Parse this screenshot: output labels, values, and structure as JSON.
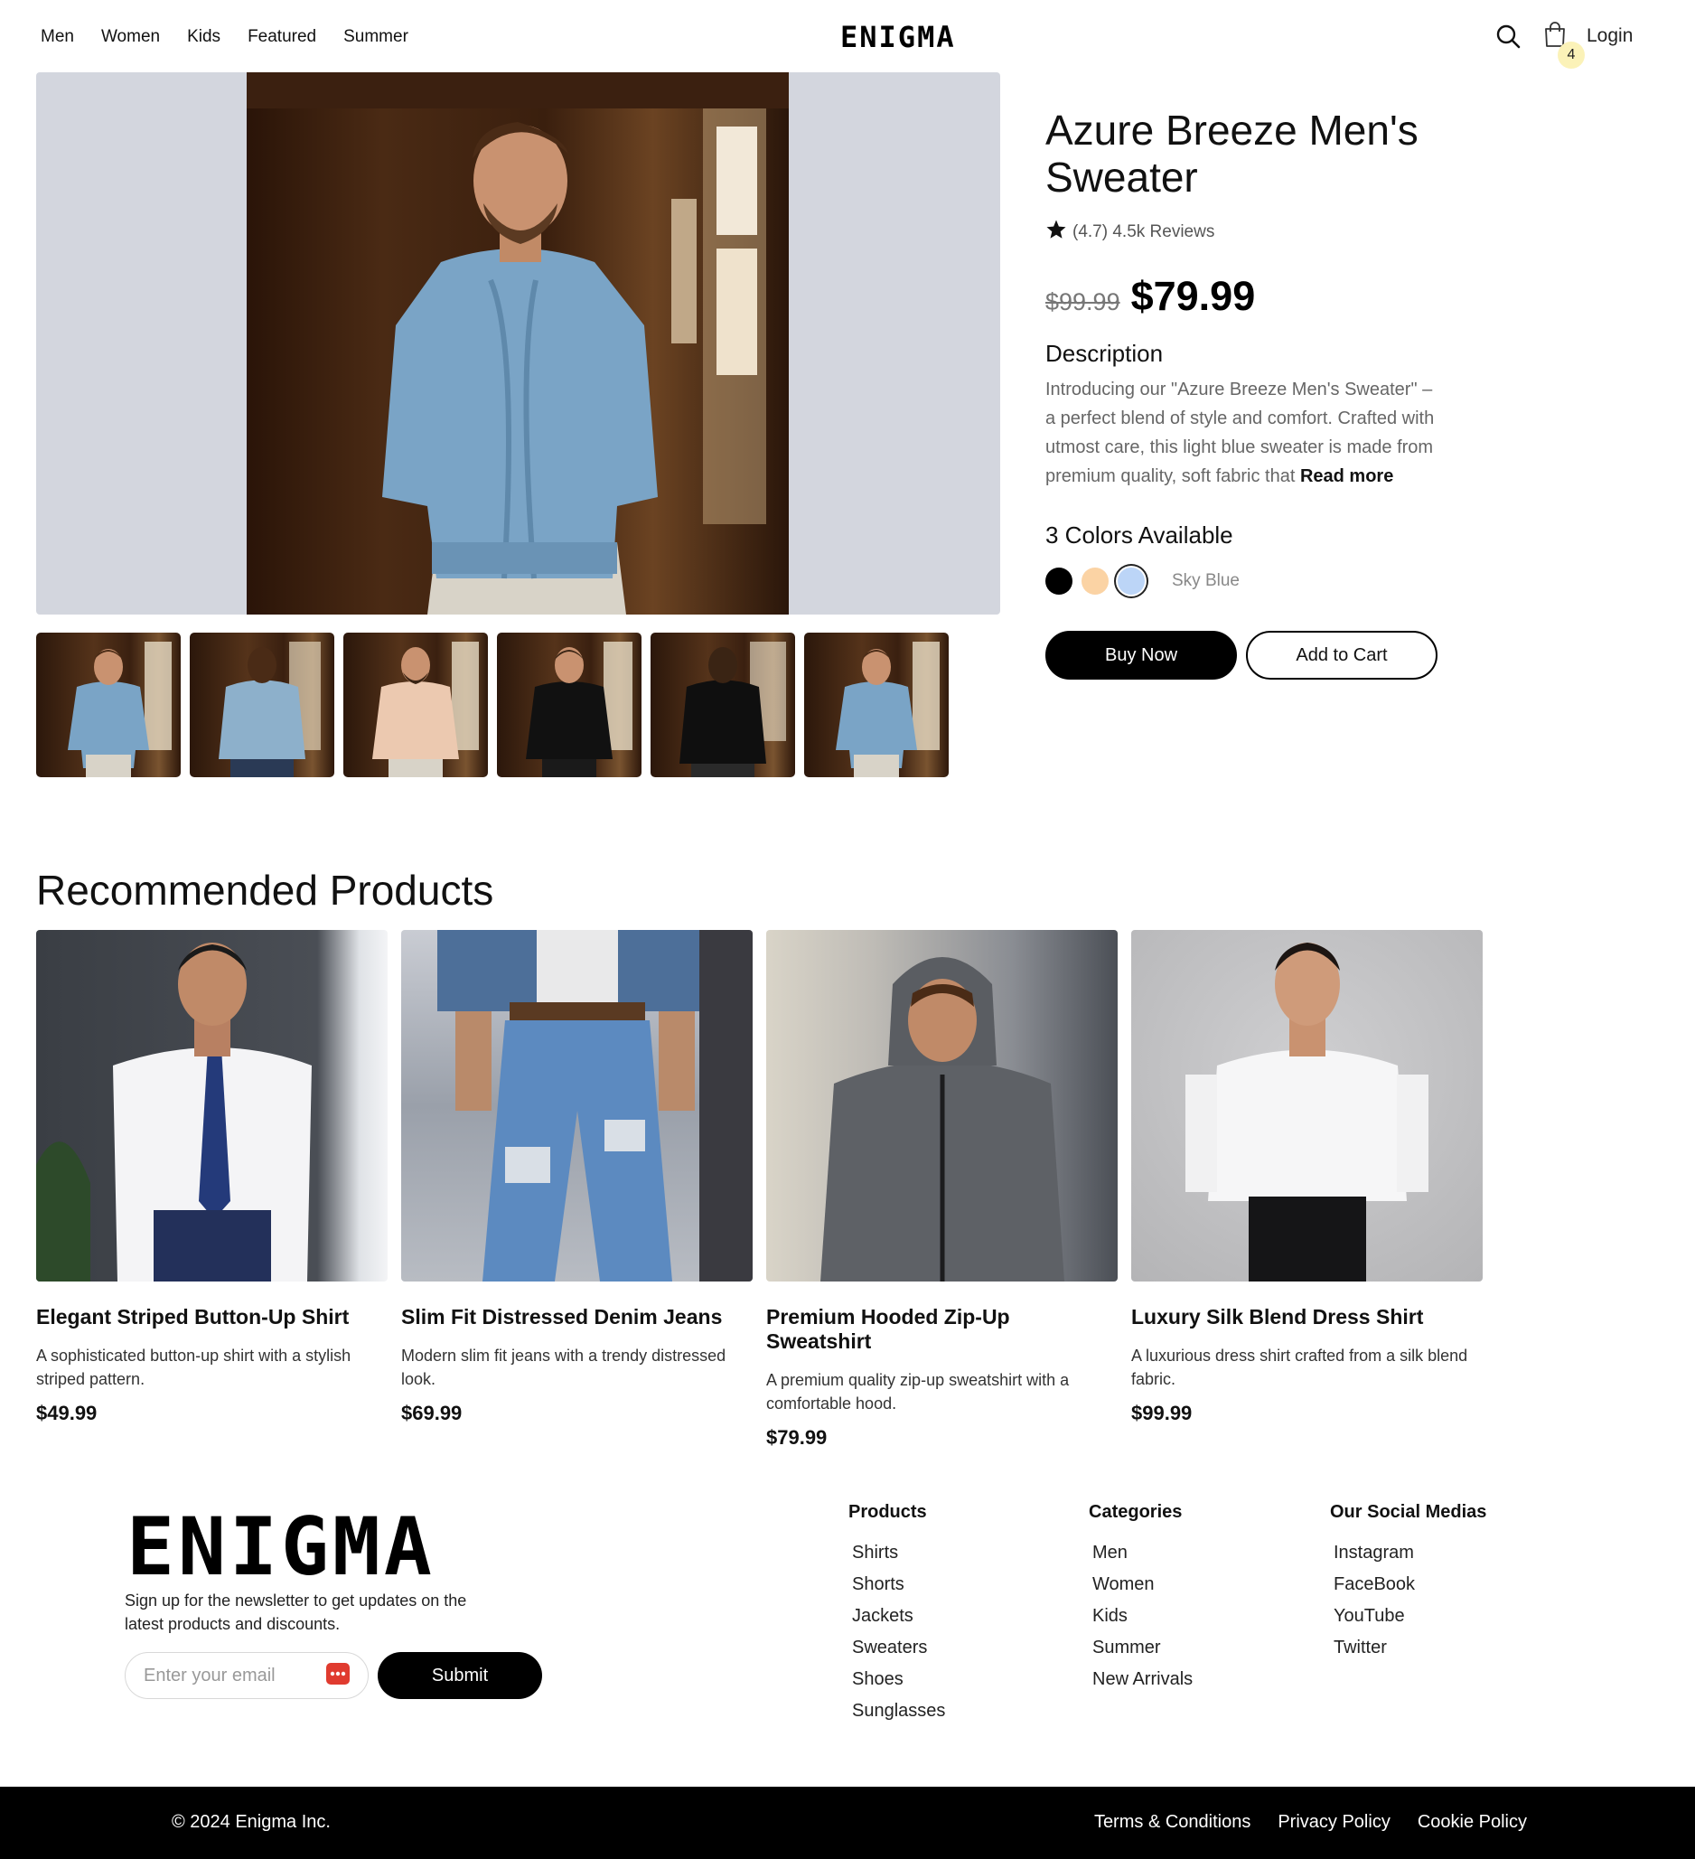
{
  "nav": {
    "links": [
      "Men",
      "Women",
      "Kids",
      "Featured",
      "Summer"
    ],
    "brand": "ENIGMA",
    "cart_count": "4",
    "login_label": "Login"
  },
  "product": {
    "title": "Azure Breeze Men's Sweater",
    "rating": "(4.7) 4.5k Reviews",
    "old_price": "$99.99",
    "price": "$79.99",
    "description_heading": "Description",
    "description": "Introducing our \"Azure Breeze Men's Sweater\" – a perfect blend of style and comfort. Crafted with utmost care, this light blue sweater is made from premium quality, soft fabric that ",
    "read_more": "Read more",
    "colors_heading": "3 Colors Available",
    "colors": [
      "#000000",
      "#fbd3a4",
      "#bcd5f7"
    ],
    "selected_color_index": 2,
    "selected_color_name": "Sky Blue",
    "buy_label": "Buy Now",
    "cart_label": "Add to Cart"
  },
  "recommended": {
    "heading": "Recommended Products",
    "items": [
      {
        "name": "Elegant Striped Button-Up Shirt",
        "desc": "A sophisticated button-up shirt with a stylish striped pattern.",
        "price": "$49.99"
      },
      {
        "name": "Slim Fit Distressed Denim Jeans",
        "desc": "Modern slim fit jeans with a trendy distressed look.",
        "price": "$69.99"
      },
      {
        "name": "Premium Hooded Zip-Up Sweatshirt",
        "desc": "A premium quality zip-up sweatshirt with a comfortable hood.",
        "price": "$79.99"
      },
      {
        "name": "Luxury Silk Blend Dress Shirt",
        "desc": "A luxurious dress shirt crafted from a silk blend fabric.",
        "price": "$99.99"
      }
    ]
  },
  "footer": {
    "brand": "ENIGMA",
    "newsletter": "Sign up for the newsletter to get updates on the latest products and discounts.",
    "email_placeholder": "Enter your email",
    "submit_label": "Submit",
    "products": {
      "heading": "Products",
      "items": [
        "Shirts",
        "Shorts",
        "Jackets",
        "Sweaters",
        "Shoes",
        "Sunglasses"
      ]
    },
    "categories": {
      "heading": "Categories",
      "items": [
        "Men",
        "Women",
        "Kids",
        "Summer",
        "New Arrivals"
      ]
    },
    "social": {
      "heading": "Our Social Medias",
      "items": [
        "Instagram",
        "FaceBook",
        "YouTube",
        "Twitter"
      ]
    },
    "copyright": "© 2024 Enigma Inc.",
    "legal": [
      "Terms & Conditions",
      "Privacy Policy",
      "Cookie Policy"
    ]
  },
  "icons": {
    "search": "search-icon",
    "cart": "shopping-bag-icon",
    "rating": "star-icon",
    "email_badge": "dots-icon"
  }
}
